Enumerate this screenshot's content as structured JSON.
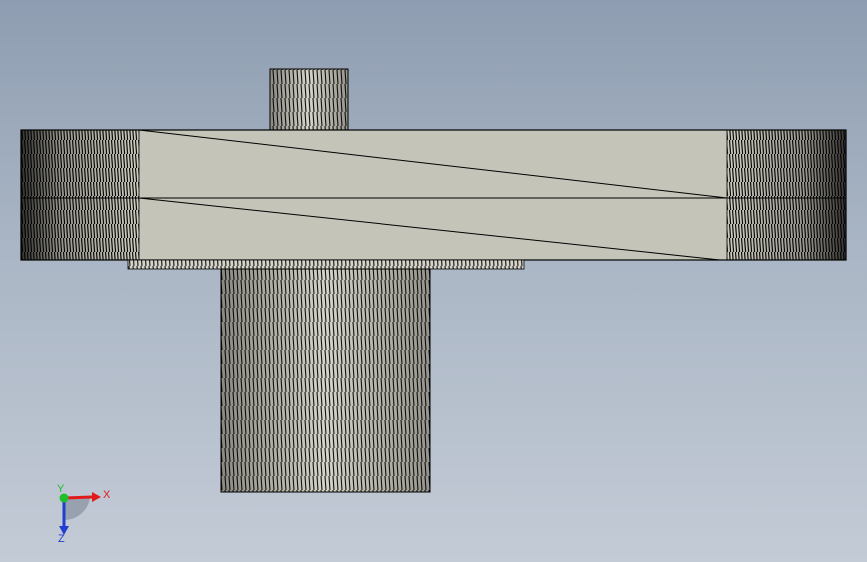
{
  "viewport": {
    "background_top": "#8e9db1",
    "background_bottom": "#c3cbd6"
  },
  "model": {
    "face_color": "#c4c4b8",
    "hatch_color": "#0b0b0b",
    "edge_color": "#000000"
  },
  "triad": {
    "x_label": "X",
    "y_label": "Y",
    "z_label": "Z",
    "x_color": "#e11b1b",
    "y_color": "#1fbf2a",
    "z_color": "#1f3fd1"
  }
}
